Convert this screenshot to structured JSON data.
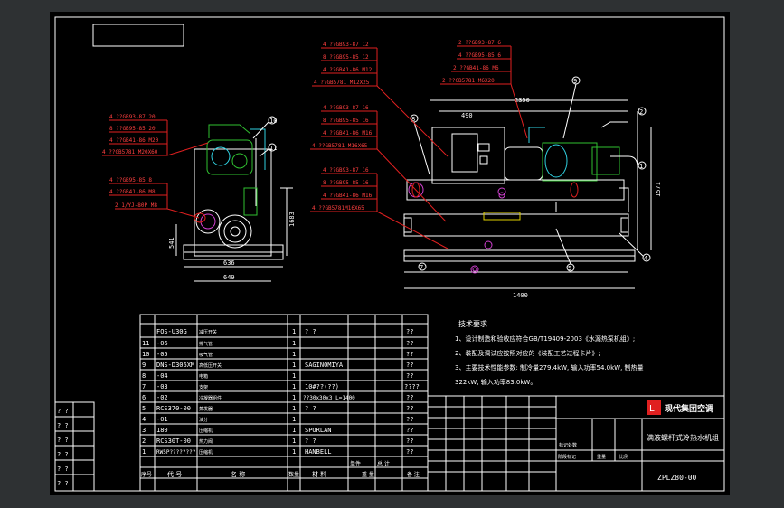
{
  "bom_rows": [
    {
      "no": "",
      "code": "FOS-U30G",
      "name": "减压开关",
      "qty": "1",
      "material": "? ?",
      "note": "??"
    },
    {
      "no": "11",
      "code": "-06",
      "name": "排气管",
      "qty": "1",
      "material": "",
      "note": "??"
    },
    {
      "no": "10",
      "code": "-05",
      "name": "吸气管",
      "qty": "1",
      "material": "",
      "note": "??"
    },
    {
      "no": "9",
      "code": "DNS-D306XM",
      "name": "高低压开关",
      "qty": "1",
      "material": "SAGINOMIYA",
      "note": "??"
    },
    {
      "no": "8",
      "code": "-04",
      "name": "电箱",
      "qty": "1",
      "material": "",
      "note": "??"
    },
    {
      "no": "7",
      "code": "-03",
      "name": "支架",
      "qty": "1",
      "material": "10#??(??)",
      "note": "????"
    },
    {
      "no": "6",
      "code": "-02",
      "name": "冷凝器组件",
      "qty": "1",
      "material": "??30x30x3 L=1400",
      "note": "??"
    },
    {
      "no": "5",
      "code": "RCS370-00",
      "name": "蒸发器",
      "qty": "1",
      "material": "? ?",
      "note": "??"
    },
    {
      "no": "4",
      "code": "-01",
      "name": "油分",
      "qty": "1",
      "material": "",
      "note": "??"
    },
    {
      "no": "3",
      "code": "180",
      "name": "压缩机",
      "qty": "1",
      "material": "SPORLAN",
      "note": "??"
    },
    {
      "no": "2",
      "code": "RCS30T-00",
      "name": "热力阀",
      "qty": "1",
      "material": "? ?",
      "note": "??"
    },
    {
      "no": "1",
      "code": "RW5P????????",
      "name": "压缩机",
      "qty": "1",
      "material": "HANBELL",
      "note": "??"
    }
  ],
  "bom_header": {
    "no": "序号",
    "code": "代  号",
    "name": "名  称",
    "qty": "数量",
    "material": "材 料",
    "unit_weight": "单件",
    "total_weight": "总 计",
    "weight": "重 量",
    "note": "备 注"
  },
  "tech_requirements": {
    "title": "技术要求",
    "lines": [
      "1、设计制造和验收应符合GB/T19409-2003《水源热泵机组》;",
      "2、装配及调试应按照对应的《装配工艺过程卡片》;",
      "3、主要技术性能参数: 制冷量279.4kW, 输入功率54.0kW, 制热量",
      "   322kW, 输入功率83.0kW。"
    ]
  },
  "title_block": {
    "company": "现代集团空调",
    "product": "满液螺杆式冷热水机组",
    "drawing_no": "ZPLZ80-00",
    "labels": {
      "scale_label": "标记处数",
      "stage": "阶段标记",
      "weight": "重量",
      "ratio": "比例"
    }
  },
  "left_column_marks": [
    "? ?",
    "? ?",
    "? ?",
    "? ?",
    "? ?",
    "? ?"
  ],
  "callouts_side": [
    "4 ??GB93-87 20",
    "8 ??GB95-85 20",
    "4 ??GB41-86 M20",
    "4 ??GB5781 M20X60",
    "4 ??GB95-85 8",
    "4 ??GB41-86 M8",
    "2 1/YJ-80P M8"
  ],
  "callouts_top_left": [
    "4 ??GB93-87 12",
    "8 ??GB95-85 12",
    "4 ??GB41-86 M12",
    "4 ??GB5781 M12X25"
  ],
  "callouts_top_right": [
    "2 ??GB93-87 6",
    "4 ??GB95-85 6",
    "2 ??GB41-86 M6",
    "2 ??GB5781 M6X20"
  ],
  "callouts_mid1": [
    "4 ??GB93-87 16",
    "8 ??GB95-85 16",
    "4 ??GB41-86 M16",
    "4 ??GB5781 M16X65"
  ],
  "callouts_mid2": [
    "4 ??GB93-87 16",
    "8 ??GB95-85 16",
    "4 ??GB41-86 M16",
    "4 ??GB5781M16X65"
  ],
  "balloons": [
    "1",
    "2",
    "4",
    "5",
    "6",
    "7",
    "8",
    "9",
    "10",
    "11",
    "12"
  ],
  "dims": {
    "width_total": "1400",
    "side_width": "649",
    "side_inner": "636",
    "h1": "1683",
    "h2": "1571",
    "h3": "541",
    "top_a": "490",
    "top_b": "2350"
  }
}
